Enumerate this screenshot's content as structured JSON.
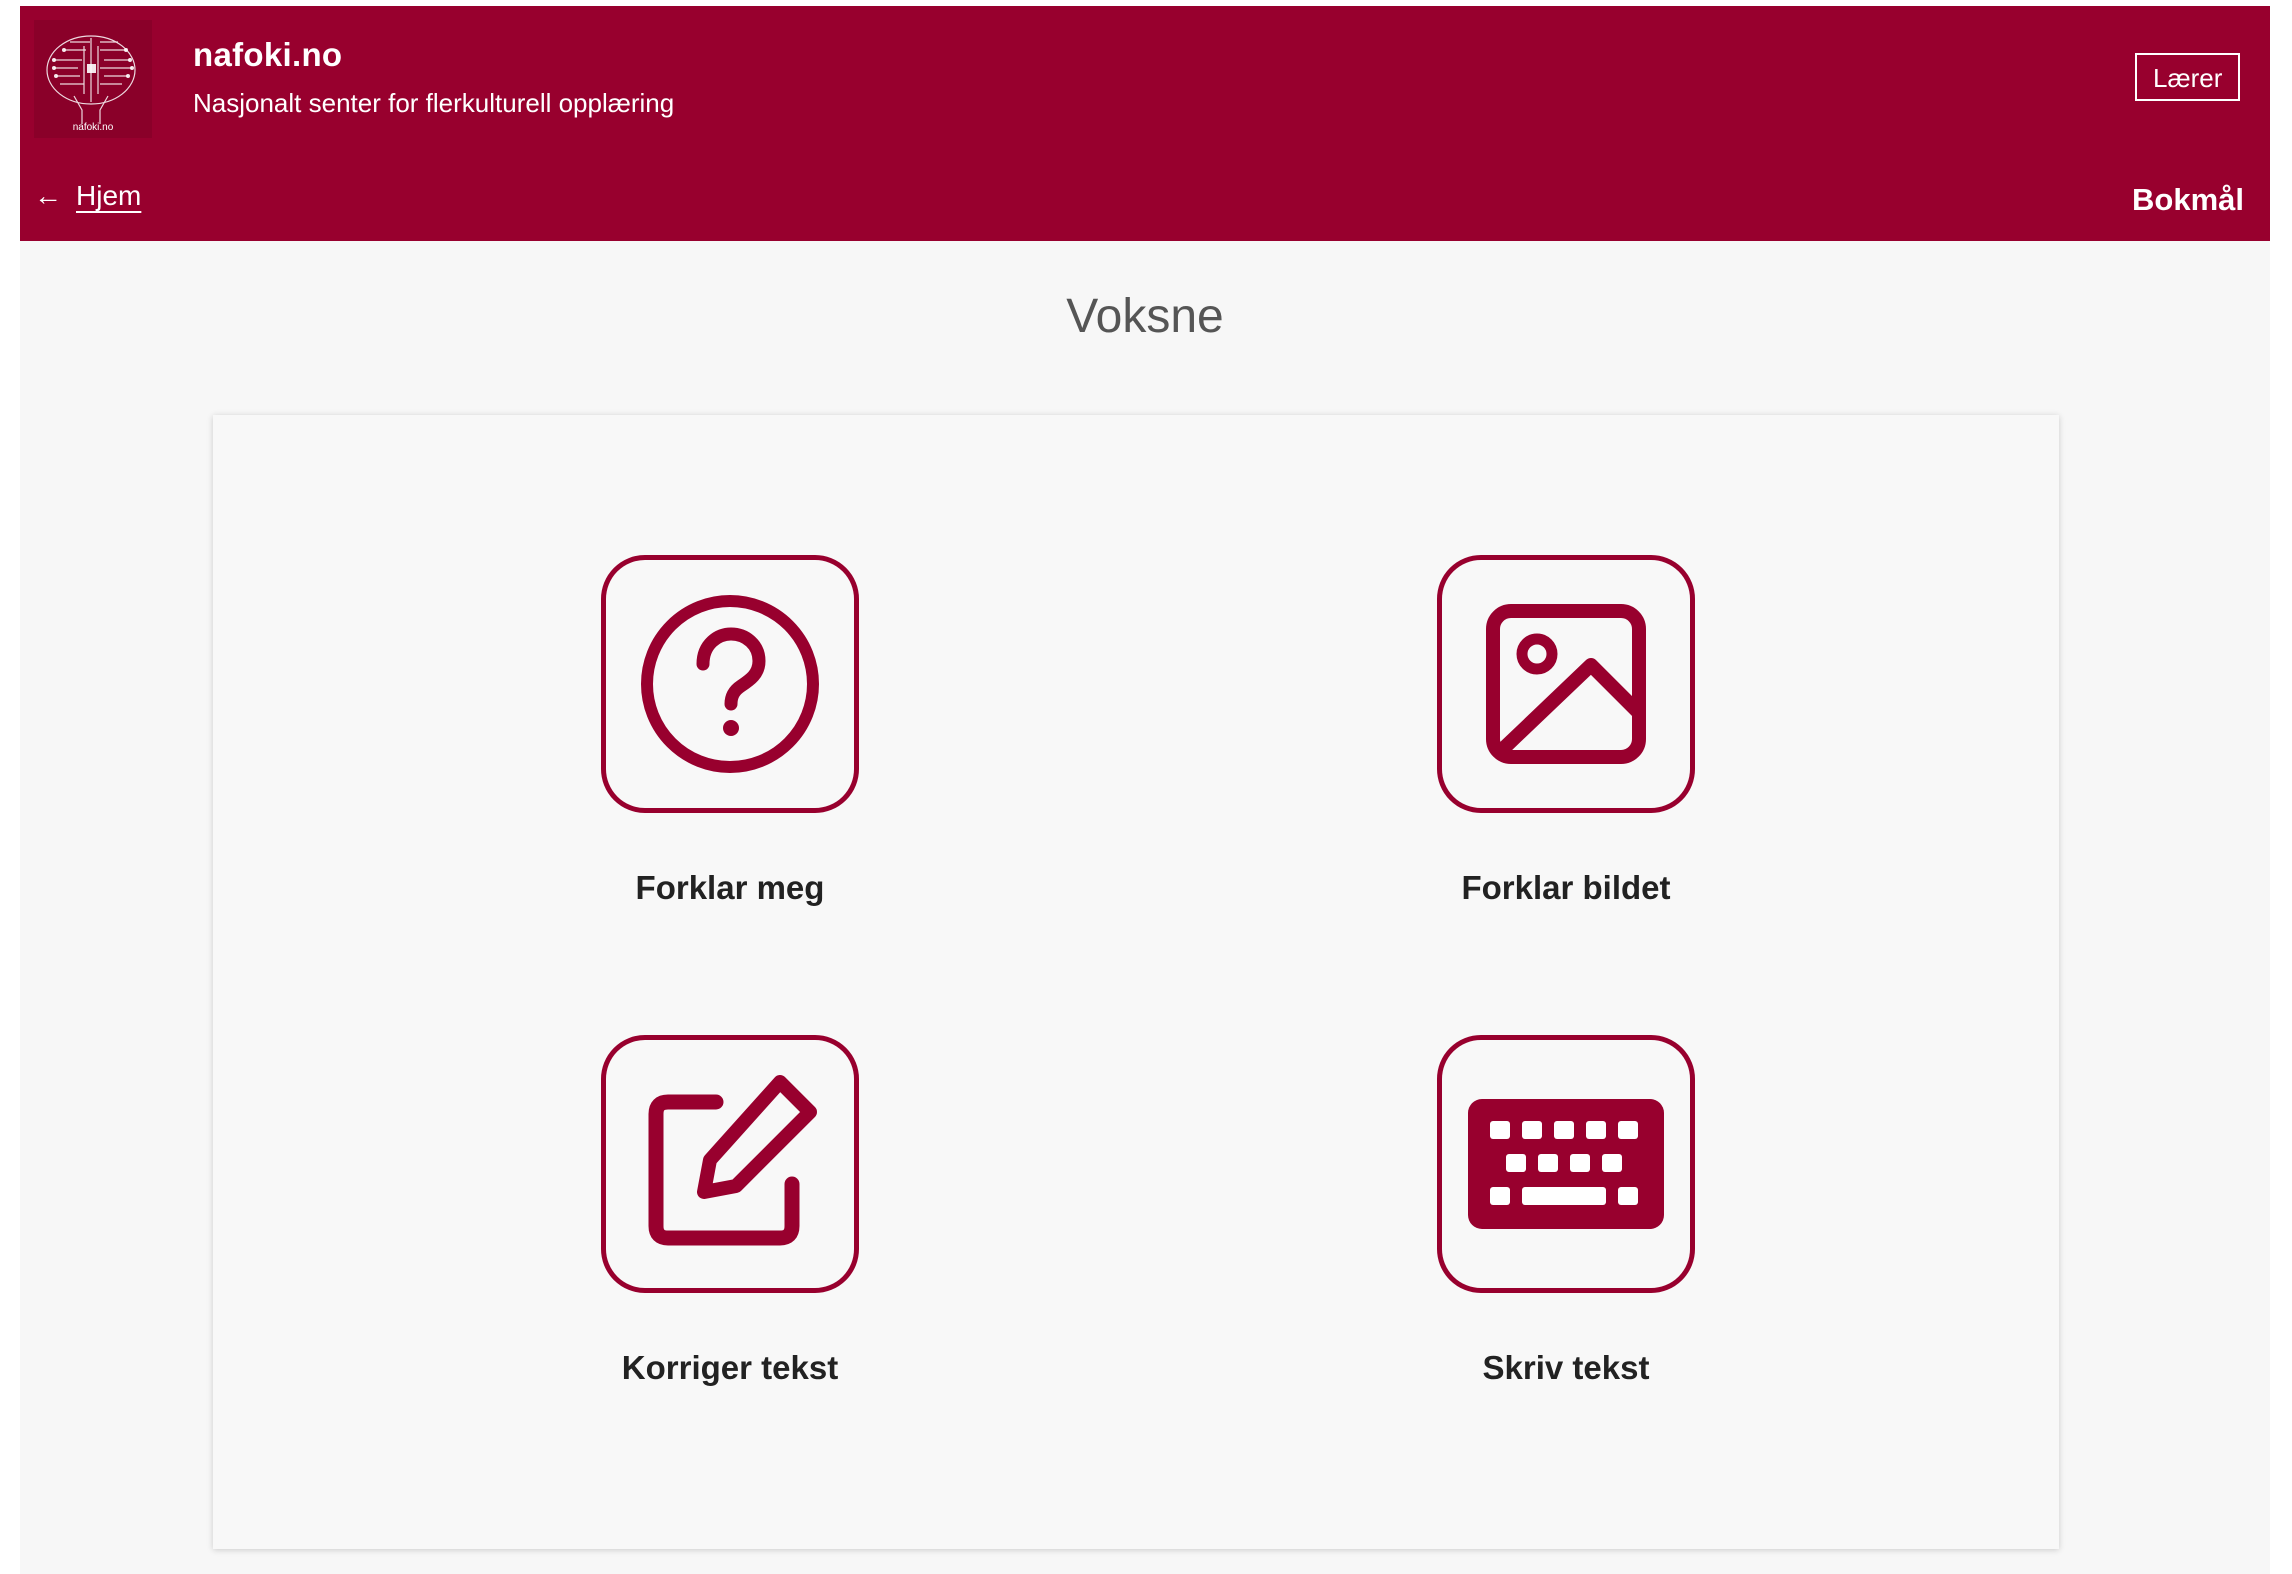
{
  "header": {
    "site_title": "nafoki.no",
    "site_subtitle": "Nasjonalt senter for flerkulturell opplæring",
    "logo_caption": "nafoki.no",
    "role_button": "Lærer",
    "home_arrow": "←",
    "home_link": "Hjem",
    "language": "Bokmål"
  },
  "main": {
    "title": "Voksne",
    "tiles": [
      {
        "label": "Forklar meg",
        "icon": "question-circle-icon"
      },
      {
        "label": "Forklar bildet",
        "icon": "image-icon"
      },
      {
        "label": "Korriger tekst",
        "icon": "edit-icon"
      },
      {
        "label": "Skriv tekst",
        "icon": "keyboard-icon"
      }
    ]
  },
  "colors": {
    "brand": "#98002e",
    "background": "#f7f7f7",
    "card": "#f8f8f8",
    "title_text": "#555555",
    "label_text": "#222222"
  }
}
